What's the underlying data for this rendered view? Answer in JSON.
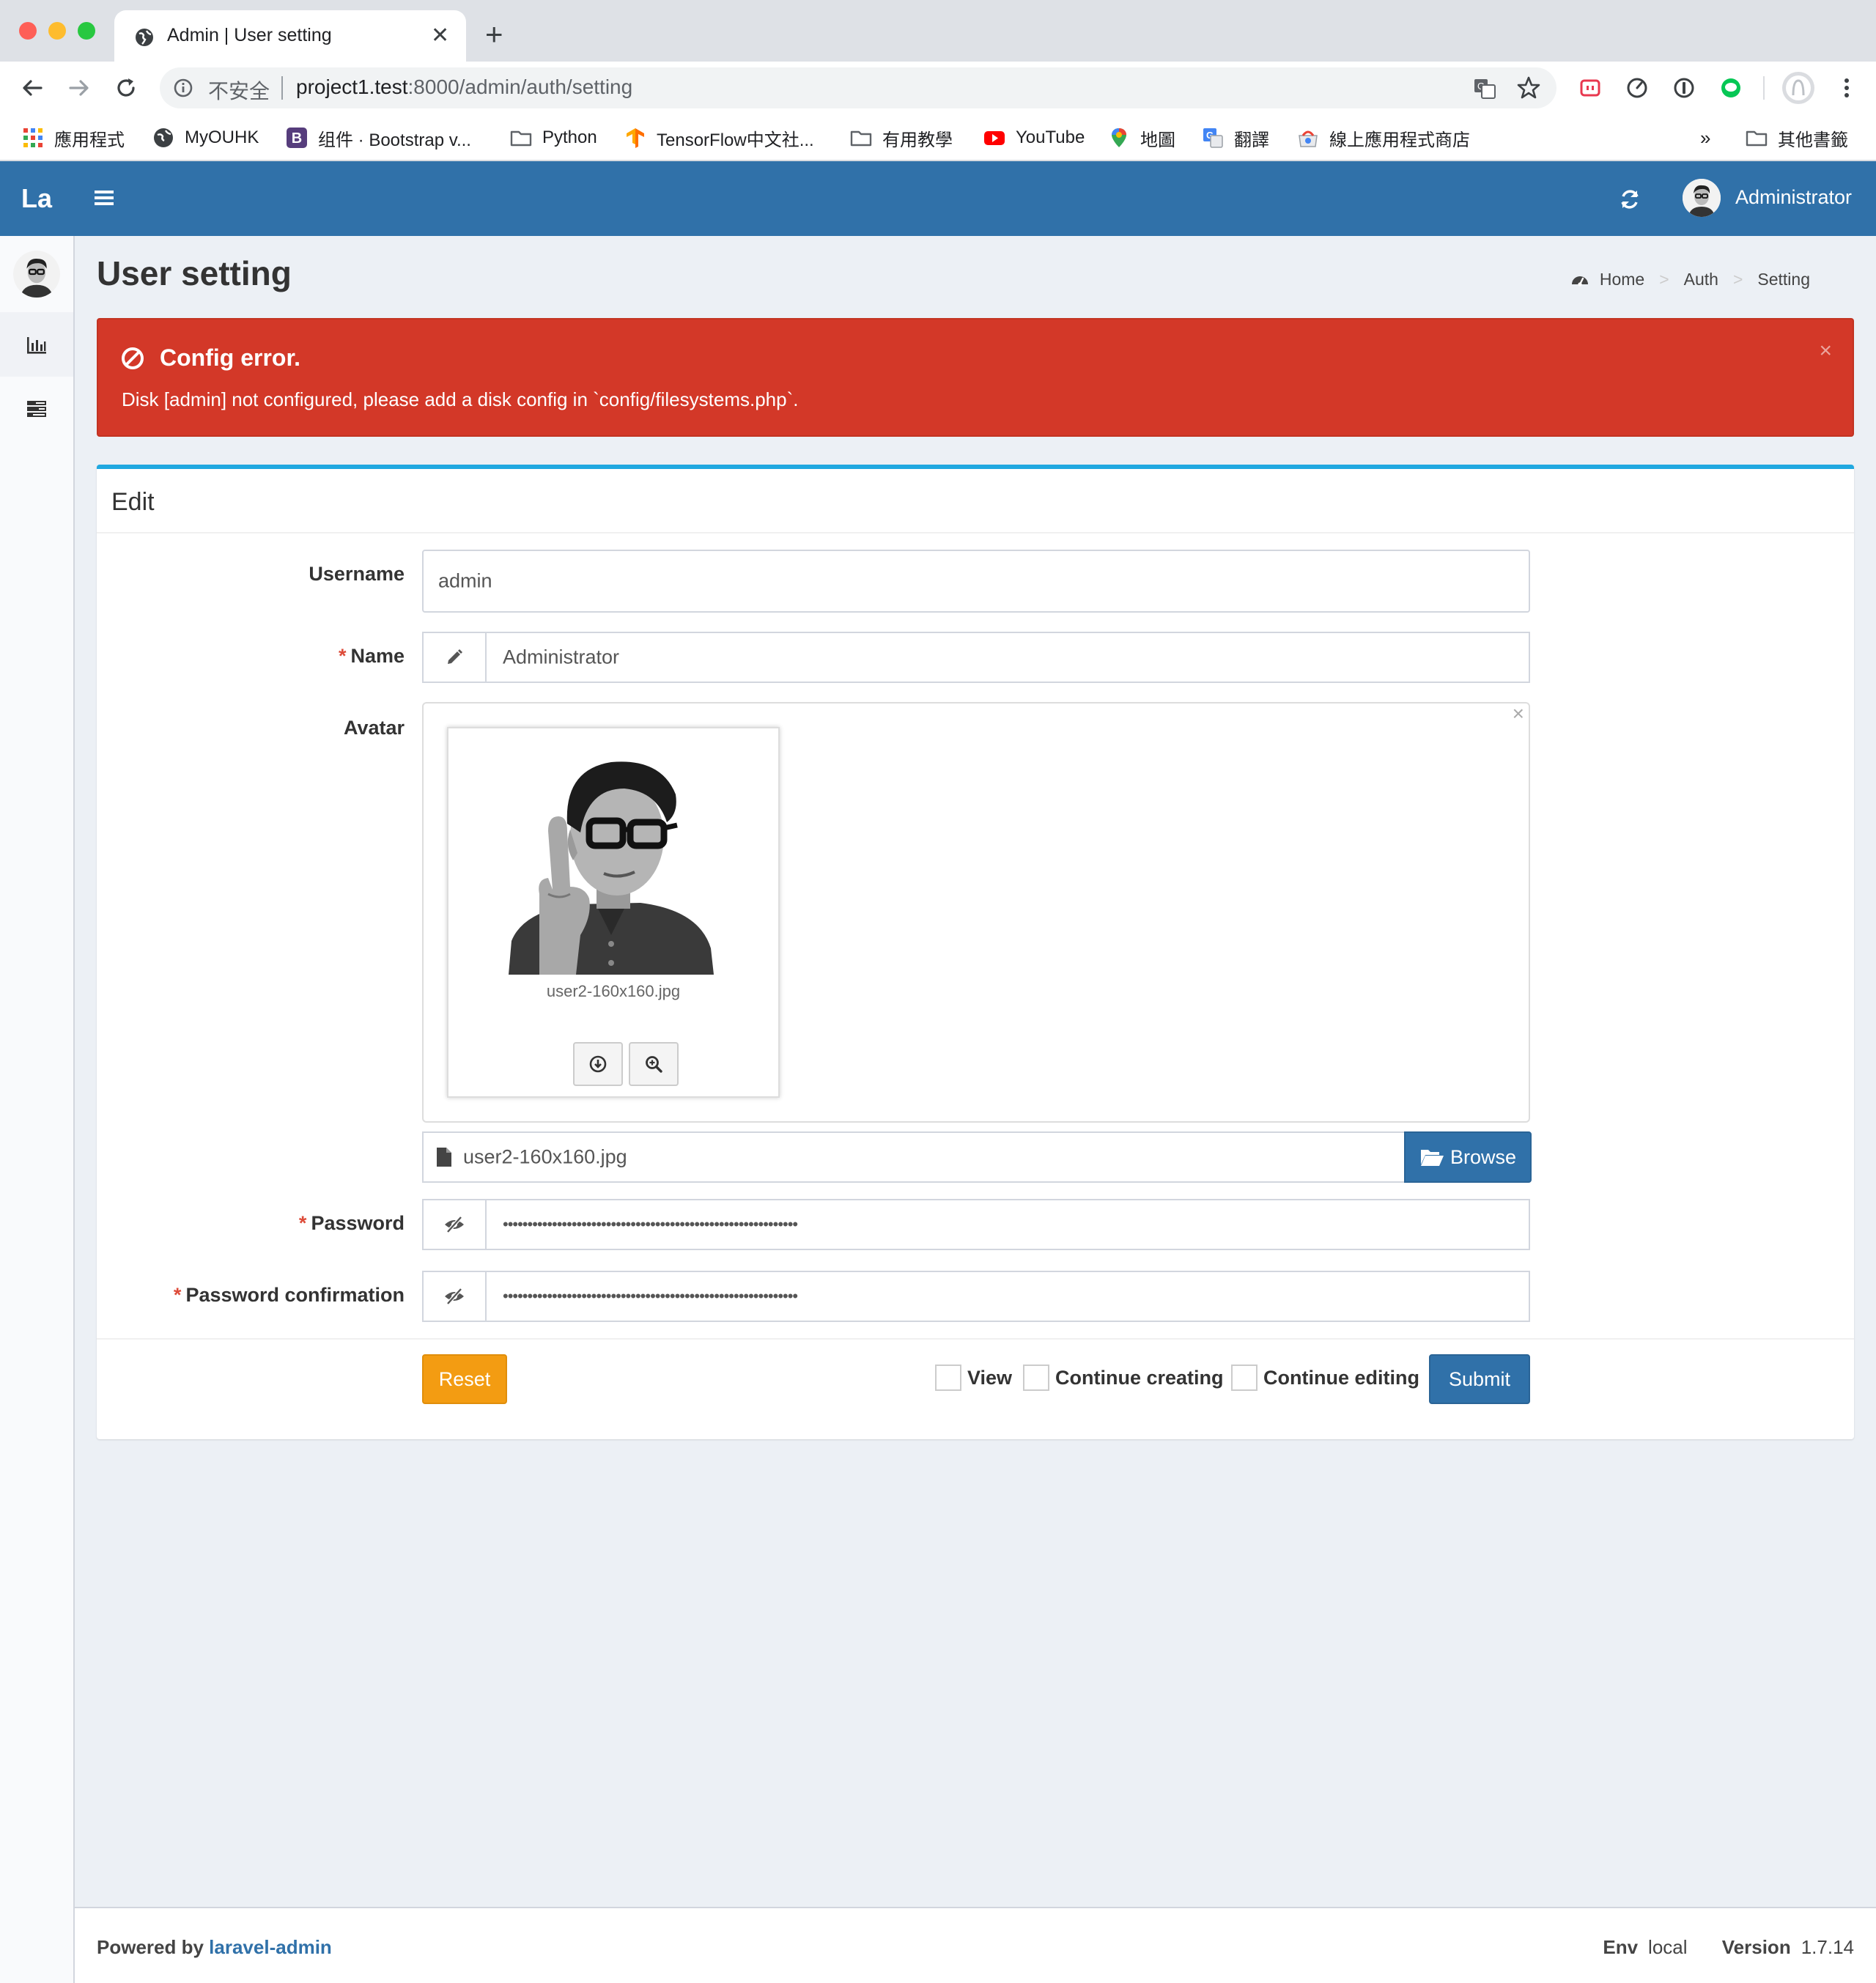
{
  "browser": {
    "tab_title": "Admin | User setting",
    "new_tab": "+",
    "tab_close": "✕",
    "insecure_label": "不安全",
    "url_host": "project1.test",
    "url_rest": ":8000/admin/auth/setting",
    "bookmarks": [
      "應用程式",
      "MyOUHK",
      "组件 · Bootstrap v...",
      "Python",
      "TensorFlow中文社...",
      "有用教學",
      "YouTube",
      "地圖",
      "翻譯",
      "線上應用程式商店"
    ],
    "bookmarks_more": "»",
    "other_bookmarks": "其他書籤"
  },
  "header": {
    "logo": "La",
    "user_name": "Administrator"
  },
  "page": {
    "title": "User setting",
    "breadcrumb": [
      "Home",
      "Auth",
      "Setting"
    ],
    "breadcrumb_sep": ">"
  },
  "alert": {
    "title": "Config error.",
    "message": "Disk [admin] not configured, please add a disk config in `config/filesystems.php`.",
    "close": "×"
  },
  "form": {
    "box_title": "Edit",
    "username_label": "Username",
    "username_value": "admin",
    "name_label": "Name",
    "name_value": "Administrator",
    "avatar_label": "Avatar",
    "avatar_filename": "user2-160x160.jpg",
    "avatar_close": "×",
    "file_value": "user2-160x160.jpg",
    "browse_label": "Browse",
    "password_label": "Password",
    "password_value": "••••••••••••••••••••••••••••••••••••••••••••••••••••••••••••",
    "password_confirm_label": "Password confirmation",
    "password_confirm_value": "••••••••••••••••••••••••••••••••••••••••••••••••••••••••••••",
    "required_mark": "*",
    "reset_label": "Reset",
    "view_label": "View",
    "continue_creating_label": "Continue creating",
    "continue_editing_label": "Continue editing",
    "submit_label": "Submit"
  },
  "footer": {
    "powered_by": "Powered by",
    "brand": "laravel-admin",
    "env_label": "Env",
    "env_value": "local",
    "version_label": "Version",
    "version_value": "1.7.14"
  },
  "icons": {
    "tab_favicon": "globe-icon",
    "back": "arrow-left-icon",
    "forward": "arrow-right-icon",
    "reload": "reload-icon",
    "info": "info-icon",
    "translate": "translate-icon",
    "star": "star-icon",
    "hamburger": "menu-icon",
    "refresh": "refresh-icon",
    "dashboard": "dashboard-icon",
    "chart": "bar-chart-icon",
    "tasks": "tasks-icon",
    "ban": "ban-icon",
    "pencil": "pencil-icon",
    "eye_slash": "eye-slash-icon",
    "file": "file-icon",
    "folder_open": "folder-open-icon",
    "download": "download-icon",
    "zoom": "zoom-in-icon"
  },
  "colors": {
    "header": "#3071a9",
    "alert": "#d33828",
    "box_accent": "#20a8e0",
    "reset": "#f39c12",
    "submit": "#3071a9"
  }
}
